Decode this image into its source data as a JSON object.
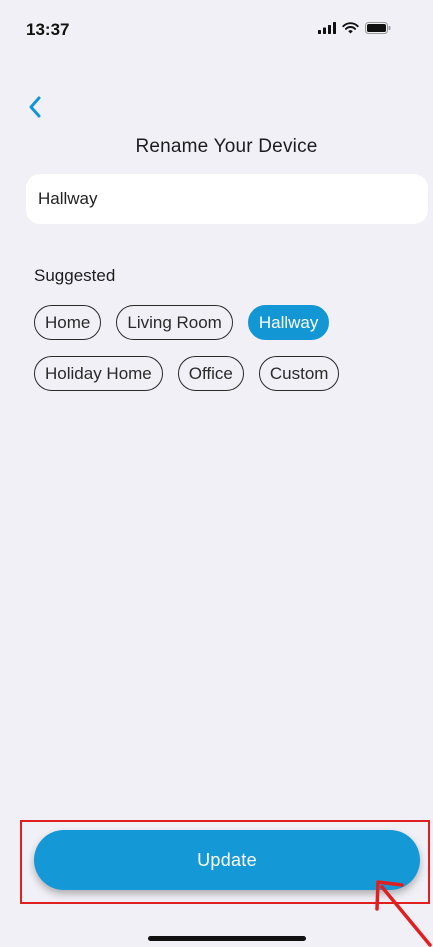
{
  "status_bar": {
    "time": "13:37"
  },
  "header": {
    "title": "Rename Your Device"
  },
  "name_field": {
    "value": "Hallway"
  },
  "suggested": {
    "label": "Suggested",
    "chips": [
      {
        "label": "Home",
        "selected": false
      },
      {
        "label": "Living Room",
        "selected": false
      },
      {
        "label": "Hallway",
        "selected": true
      },
      {
        "label": "Holiday Home",
        "selected": false
      },
      {
        "label": "Office",
        "selected": false
      },
      {
        "label": "Custom",
        "selected": false
      }
    ]
  },
  "actions": {
    "update_label": "Update"
  },
  "colors": {
    "accent": "#1598d6",
    "background": "#f1f0f6",
    "annotation": "#e02020"
  },
  "icons": {
    "back": "chevron-left-icon",
    "signal": "signal-bars-icon",
    "wifi": "wifi-icon",
    "battery": "battery-icon"
  }
}
